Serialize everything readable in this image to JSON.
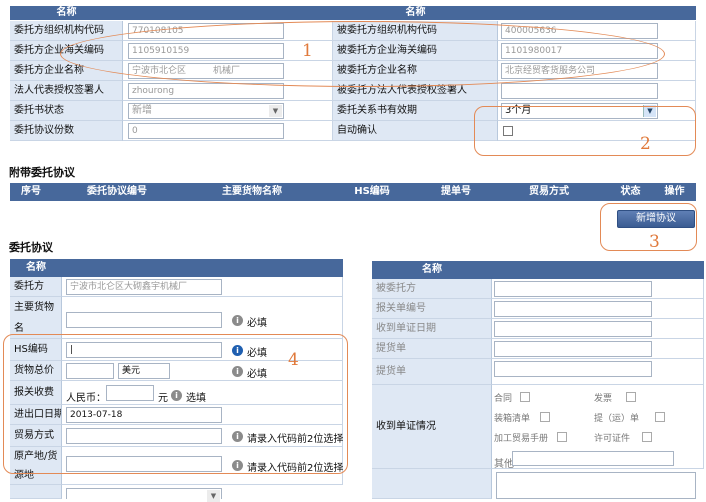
{
  "top": {
    "col_header": "名称",
    "rows": [
      {
        "l1": "委托方组织机构代码",
        "v1": "770108105",
        "l2": "被委托方组织机构代码",
        "v2": "400005636"
      },
      {
        "l1": "委托方企业海关编码",
        "v1": "1105910159",
        "l2": "被委托方企业海关编码",
        "v2": "1101980017"
      },
      {
        "l1": "委托方企业名称",
        "v1": "宁波市北仑区　　　机械厂",
        "l2": "被委托方企业名称",
        "v2": "北京经贸客货服务公司"
      },
      {
        "l1": "法人代表授权签署人",
        "v1": "zhourong",
        "l2": "被委托方法人代表授权签署人",
        "v2": ""
      },
      {
        "l1": "委托书状态",
        "v1": "新增",
        "l2": "委托关系书有效期",
        "v2": "3个月"
      },
      {
        "l1": "委托协议份数",
        "v1": "0",
        "l2": "自动确认",
        "v2": ""
      }
    ]
  },
  "attached": {
    "title": "附带委托协议",
    "columns": [
      "序号",
      "委托协议编号",
      "主要货物名称",
      "HS编码",
      "提单号",
      "贸易方式",
      "状态",
      "操作"
    ],
    "new_button": "新增协议"
  },
  "agreement": {
    "title": "委托协议",
    "left_header": "名称",
    "consignor_label": "委托方",
    "consignor_value": "宁波市北仑区大砌鑫宇机械厂",
    "goods_label_1": "主要货物名",
    "goods_label_2": "称",
    "required": "必填",
    "hs_label": "HS编码",
    "total_label": "货物总价",
    "currency": "美元",
    "fee_label": "报关收费",
    "rmb_label": "人民币：",
    "yuan_label": "元",
    "optional": "选填",
    "date_label": "进出口日期",
    "date_value": "2013-07-18",
    "trade_label": "贸易方式",
    "code_hint": "请录入代码前2位选择",
    "origin_label_1": "原产地/货",
    "origin_label_2": "源地",
    "right_header": "名称",
    "right_rows": [
      "被委托方",
      "报关单编号",
      "收到单证日期",
      "提货单",
      "提货单"
    ],
    "docs_label": "收到单证情况",
    "docs": [
      "合同",
      "发票",
      "装箱清单",
      "提（运）单",
      "加工贸易手册",
      "许可证件"
    ],
    "other_label": "其他"
  },
  "annotations": [
    "1",
    "2",
    "3",
    "4"
  ],
  "colors": {
    "header": "#47689b",
    "label_bg": "#dfe8f4",
    "annotation": "#e38a56"
  }
}
